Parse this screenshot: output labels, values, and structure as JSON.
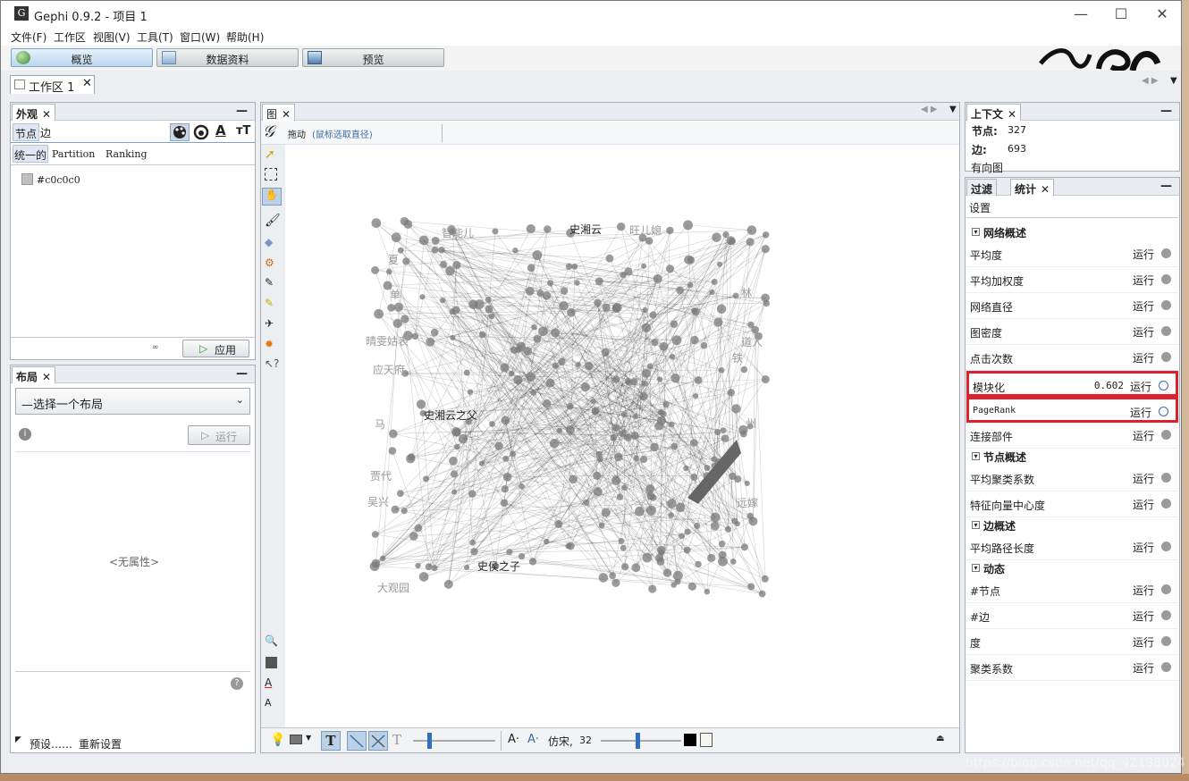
{
  "window": {
    "title": "Gephi 0.9.2 - 项目 1",
    "min": "—",
    "max": "☐",
    "close": "✕"
  },
  "menu": [
    "文件(F)",
    "工作区",
    "视图(V)",
    "工具(T)",
    "窗口(W)",
    "帮助(H)"
  ],
  "modes": [
    "概览",
    "数据资料",
    "预览"
  ],
  "workspace_tab": {
    "label": "工作区 1",
    "close": "✕"
  },
  "appearance": {
    "tab": "外观",
    "tabs": [
      "节点",
      "边"
    ],
    "subtabs": [
      "统一的",
      "Partition",
      "Ranking"
    ],
    "color_value": "#c0c0c0",
    "color_hex": "#c0c0c0",
    "apply": "应用"
  },
  "layout": {
    "tab": "布局",
    "select": "—选择一个布局",
    "run": "运行",
    "no_props": "<无属性>",
    "presets": "预设……",
    "reset": "重新设置"
  },
  "graph": {
    "tab": "图",
    "mode": "拖动",
    "mode_hint": "(鼠标选取直径)",
    "font_label": "仿宋,",
    "font_size": "32",
    "labels": [
      "史湘云",
      "史湘云之父",
      "史侯之子",
      "智能儿",
      "旺儿媳",
      "晴雯姑表",
      "应天府",
      "马",
      "贾代",
      "吴兴",
      "大观园",
      "单",
      "夏",
      "铁",
      "林",
      "远嫁",
      "道人",
      "州"
    ]
  },
  "context": {
    "tab": "上下文",
    "nodes_label": "节点:",
    "nodes": "327",
    "edges_label": "边:",
    "edges": "693",
    "graph_type": "有向图"
  },
  "stats": {
    "tabs": [
      "过滤",
      "统计"
    ],
    "settings": "设置",
    "run_label": "运行",
    "sections": [
      {
        "title": "网络概述",
        "rows": [
          {
            "name": "平均度",
            "value": ""
          },
          {
            "name": "平均加权度",
            "value": ""
          },
          {
            "name": "网络直径",
            "value": ""
          },
          {
            "name": "图密度",
            "value": ""
          },
          {
            "name": "点击次数",
            "value": ""
          },
          {
            "name": "模块化",
            "value": "0.602",
            "highlight": true
          },
          {
            "name": "PageRank",
            "value": "",
            "highlight": true
          },
          {
            "name": "连接部件",
            "value": ""
          }
        ]
      },
      {
        "title": "节点概述",
        "rows": [
          {
            "name": "平均聚类系数",
            "value": ""
          },
          {
            "name": "特征向量中心度",
            "value": ""
          }
        ]
      },
      {
        "title": "边概述",
        "rows": [
          {
            "name": "平均路径长度",
            "value": ""
          }
        ]
      },
      {
        "title": "动态",
        "rows": [
          {
            "name": "#节点",
            "value": ""
          },
          {
            "name": "#边",
            "value": ""
          },
          {
            "name": "度",
            "value": ""
          },
          {
            "name": "聚类系数",
            "value": ""
          }
        ]
      }
    ]
  },
  "watermark": "https://blog.csdn.net/qq_42198024",
  "colors": {
    "highlight": "#e0202a",
    "accent": "#3b6ea5"
  }
}
